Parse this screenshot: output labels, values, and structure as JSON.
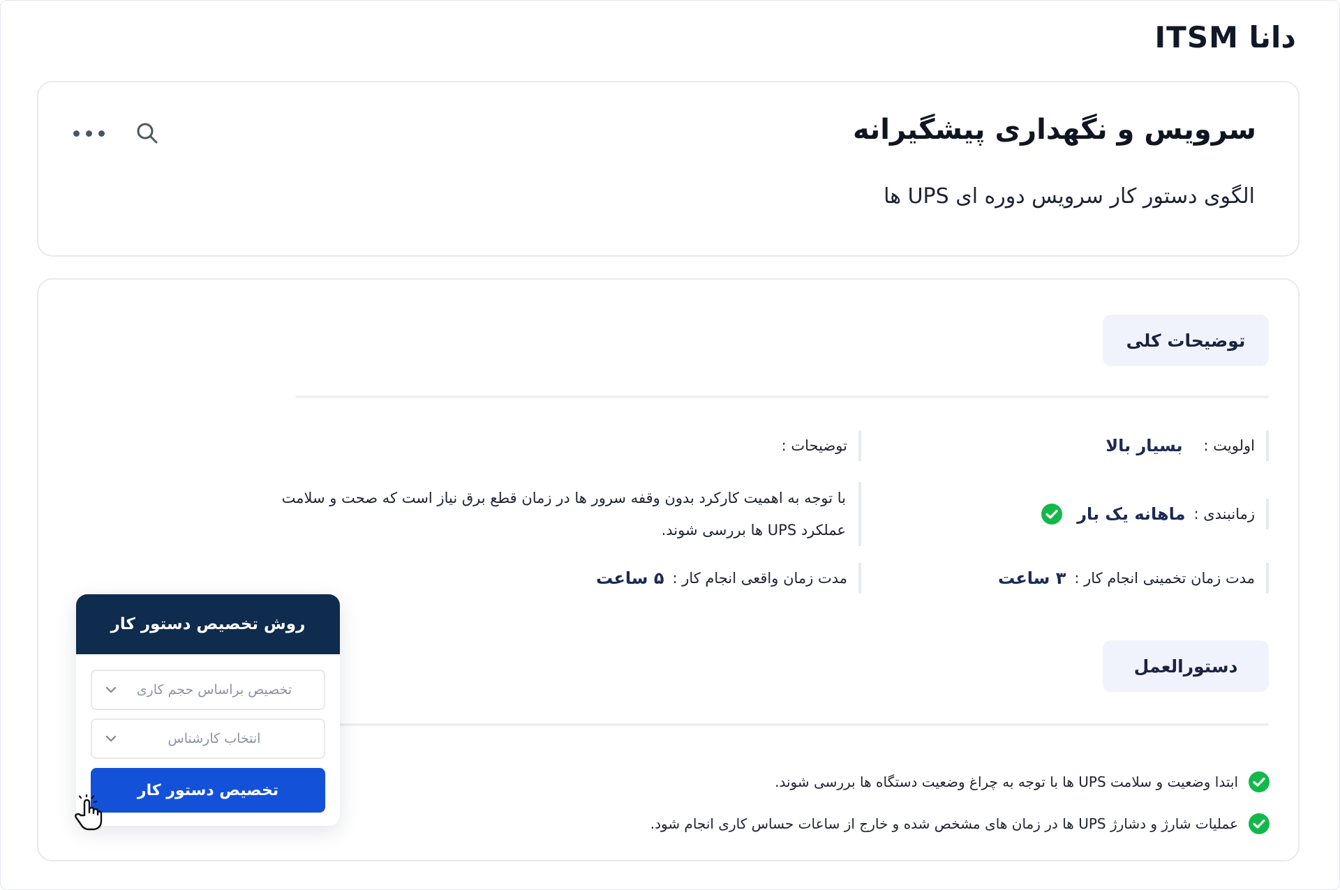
{
  "app": {
    "logo": "دانا ITSM"
  },
  "header": {
    "title": "سرویس و نگهداری پیشگیرانه",
    "subtitle": "الگوی دستور کار سرویس دوره ای UPS ها",
    "search_icon": "search-icon",
    "more_icon": "more-dots-icon"
  },
  "general": {
    "tab_label": "توضیحات کلی",
    "priority": {
      "label": "اولویت :",
      "value": "بسیار بالا"
    },
    "schedule": {
      "label": "زمانبندی :",
      "value": "ماهانه یک بار",
      "icon": "check-circle-icon"
    },
    "estimated": {
      "label": "مدت زمان تخمینی انجام کار :",
      "value": "۳ ساعت"
    },
    "description": {
      "label": "توضیحات :",
      "line1": "با توجه به اهمیت کارکرد بدون وقفه سرور ها در زمان قطع برق نیاز است که صحت و سلامت",
      "line2": "عملکرد UPS ها بررسی شوند."
    },
    "actual": {
      "label": "مدت زمان واقعی انجام کار :",
      "value": "۵ ساعت"
    }
  },
  "instructions": {
    "tab_label": "دستورالعمل",
    "items": [
      "ابتدا وضعیت و سلامت UPS ها با توجه به چراغ وضعیت دستگاه ها بررسی شوند.",
      "عملیات شارژ و دشارژ UPS ها در زمان های مشخص شده و خارج از ساعات حساس کاری انجام شود."
    ]
  },
  "assign_popup": {
    "title": "روش تخصیص دستور کار",
    "method_select": "تخصیص براساس حجم کاری",
    "expert_select": "انتخاب کارشناس",
    "button_label": "تخصیص دستور کار"
  },
  "colors": {
    "accent": "#1351d8",
    "header_dark": "#0f2b4d",
    "success": "#12b94a",
    "tab_bg": "#f1f3fc"
  }
}
